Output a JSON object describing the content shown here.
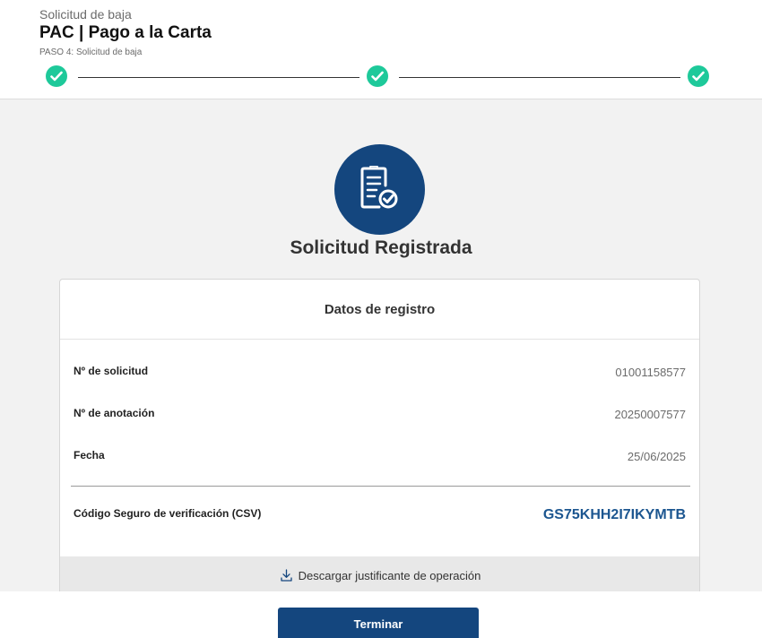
{
  "header": {
    "subtitle": "Solicitud de baja",
    "title": "PAC | Pago a la Carta",
    "step_text": "PASO 4: Solicitud de baja",
    "steps": [
      {
        "status": "completed",
        "icon": "check-icon"
      },
      {
        "status": "completed",
        "icon": "check-icon"
      },
      {
        "status": "completed",
        "icon": "check-icon"
      }
    ]
  },
  "main": {
    "icon": "document-check-icon",
    "title": "Solicitud Registrada"
  },
  "card": {
    "title": "Datos de registro",
    "rows": [
      {
        "label": "Nº de solicitud",
        "value": "01001158577"
      },
      {
        "label": "Nº de anotación",
        "value": "20250007577"
      },
      {
        "label": "Fecha",
        "value": "25/06/2025"
      }
    ],
    "csv": {
      "label": "Código Seguro de verificación (CSV)",
      "value": "GS75KHH2I7IKYMTB"
    },
    "download": {
      "icon": "download-icon",
      "label": "Descargar justificante de operación"
    }
  },
  "footer": {
    "button_label": "Terminar"
  },
  "colors": {
    "primary": "#14467e",
    "success": "#1ec99a",
    "csv": "#1c5690"
  }
}
